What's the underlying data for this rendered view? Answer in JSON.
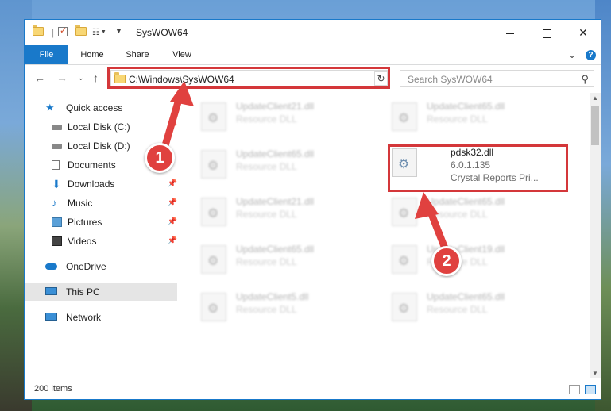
{
  "window": {
    "title": "SysWOW64",
    "controls": {
      "minimize": "",
      "maximize": "",
      "close": "✕"
    }
  },
  "ribbon": {
    "tabs": [
      "File",
      "Home",
      "Share",
      "View"
    ],
    "expand_glyph": "⌄",
    "help_glyph": "?"
  },
  "address": {
    "path": "C:\\Windows\\SysWOW64",
    "search_placeholder": "Search SysWOW64"
  },
  "nav": {
    "items": [
      {
        "label": "Quick access",
        "icon": "star-icon"
      },
      {
        "label": "Local Disk (C:)",
        "icon": "drive-icon"
      },
      {
        "label": "Local Disk (D:)",
        "icon": "drive-icon"
      },
      {
        "label": "Documents",
        "icon": "documents-icon"
      },
      {
        "label": "Downloads",
        "icon": "download-icon"
      },
      {
        "label": "Music",
        "icon": "music-icon"
      },
      {
        "label": "Pictures",
        "icon": "pictures-icon"
      },
      {
        "label": "Videos",
        "icon": "videos-icon"
      },
      {
        "label": "OneDrive",
        "icon": "cloud-icon"
      },
      {
        "label": "This PC",
        "icon": "computer-icon"
      },
      {
        "label": "Network",
        "icon": "network-icon"
      }
    ]
  },
  "files": [
    {
      "name": "UpdateClient21.dll",
      "type": "Resource DLL"
    },
    {
      "name": "UpdateClient65.dll",
      "type": "Resource DLL"
    },
    {
      "name": "UpdateClient65.dll",
      "type": "Resource DLL"
    },
    {
      "name": "pdsk32.dll",
      "version": "6.0.1.135",
      "description": "Crystal Reports Pri..."
    },
    {
      "name": "UpdateClient21.dll",
      "type": "Resource DLL"
    },
    {
      "name": "UpdateClient65.dll",
      "type": "Resource DLL"
    },
    {
      "name": "UpdateClient65.dll",
      "type": "Resource DLL"
    },
    {
      "name": "UpdateClient19.dll",
      "type": "Resource DLL"
    },
    {
      "name": "UpdateClient5.dll",
      "type": "Resource DLL"
    },
    {
      "name": "UpdateClient65.dll",
      "type": "Resource DLL"
    }
  ],
  "status": {
    "item_count": "200 items"
  },
  "annotations": {
    "step1": "1",
    "step2": "2",
    "color": "#d4373a"
  }
}
